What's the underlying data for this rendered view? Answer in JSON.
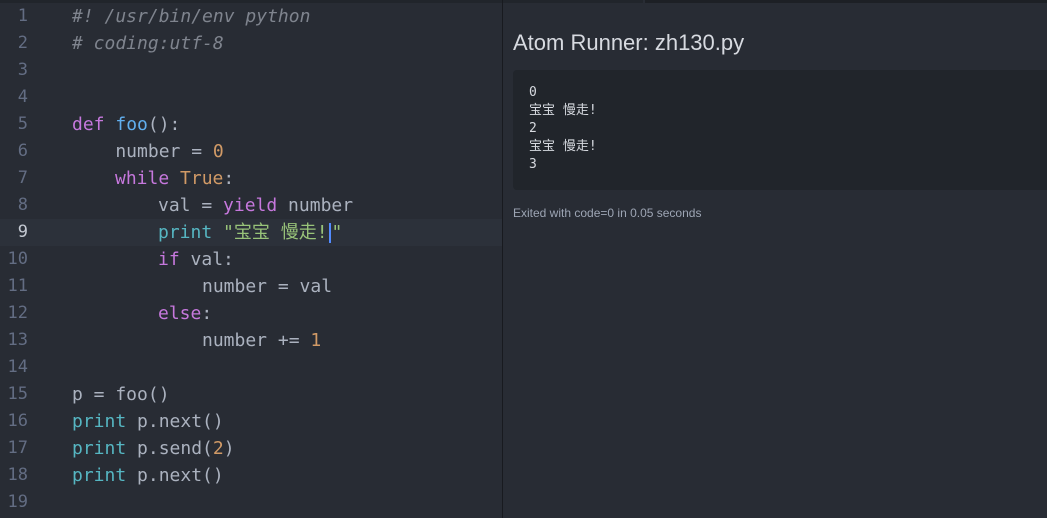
{
  "editor": {
    "line_numbers": [
      "1",
      "2",
      "3",
      "4",
      "5",
      "6",
      "7",
      "8",
      "9",
      "10",
      "11",
      "12",
      "13",
      "14",
      "15",
      "16",
      "17",
      "18",
      "19"
    ],
    "cursor_line": 9,
    "tokens": {
      "l1": "#! /usr/bin/env python",
      "l2": "# coding:utf-8",
      "l5_def": "def",
      "l5_name": "foo",
      "l5_rest": "():",
      "l6_a": "    number = ",
      "l6_num": "0",
      "l7_while": "while",
      "l7_true": "True",
      "l7_colon": ":",
      "l8_a": "val = ",
      "l8_yield": "yield",
      "l8_b": " number",
      "l9_print": "print",
      "l9_str_a": "\"宝宝 慢走!",
      "l9_str_b": "\"",
      "l10_if": "if",
      "l10_rest": " val:",
      "l11": "number = val",
      "l12_else": "else",
      "l12_colon": ":",
      "l13_a": "number += ",
      "l13_num": "1",
      "l15": "p = foo()",
      "l16_print": "print",
      "l16_rest": " p.next()",
      "l17_print": "print",
      "l17_a": " p.send(",
      "l17_num": "2",
      "l17_b": ")",
      "l18_print": "print",
      "l18_rest": " p.next()"
    }
  },
  "runner": {
    "title": "Atom Runner: zh130.py",
    "output_lines": [
      "0",
      "宝宝 慢走!",
      "2",
      "宝宝 慢走!",
      "3"
    ],
    "exit_message": "Exited with code=0 in 0.05 seconds"
  },
  "colors": {
    "editor_bg": "#282c34",
    "keyword": "#c678dd",
    "function": "#61afef",
    "builtin": "#56b6c2",
    "number": "#d19a66",
    "string": "#98c379",
    "comment": "#7f848e",
    "cursor": "#528bff"
  }
}
